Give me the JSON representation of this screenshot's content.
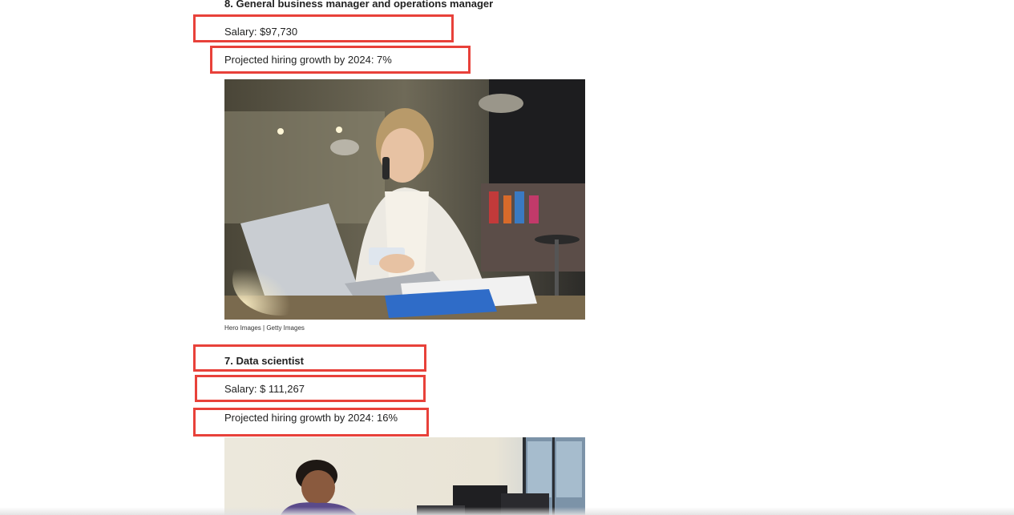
{
  "items": [
    {
      "title": "8. General business manager and operations manager",
      "salary": "Salary: $97,730",
      "growth": "Projected hiring growth by 2024: 7%",
      "credit": "Hero Images | Getty Images"
    },
    {
      "title": "7. Data scientist",
      "salary": "Salary: $ 111,267",
      "growth": "Projected hiring growth by 2024: 16%"
    }
  ],
  "colors": {
    "highlight": "#e8413a",
    "text": "#222222"
  }
}
